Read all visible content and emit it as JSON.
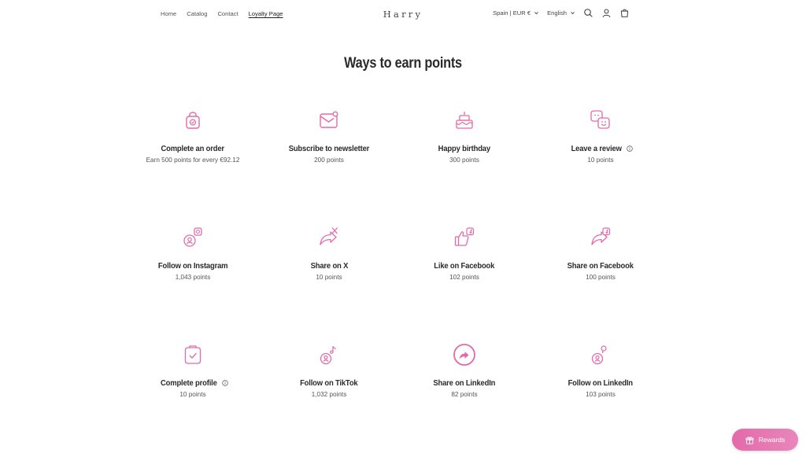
{
  "header": {
    "nav": [
      "Home",
      "Catalog",
      "Contact",
      "Loyalty Page"
    ],
    "logo": "Harry",
    "region": "Spain | EUR €",
    "language": "English"
  },
  "page_title": "Ways to earn points",
  "colors": {
    "accent": "#e36aa9",
    "text": "#2a2a2a"
  },
  "rules": [
    {
      "name": "Complete an order",
      "points": "Earn 500 points for every €92.12",
      "icon": "shopping-bag-icon",
      "info": false
    },
    {
      "name": "Subscribe to newsletter",
      "points": "200 points",
      "icon": "newsletter-icon",
      "info": false
    },
    {
      "name": "Happy birthday",
      "points": "300 points",
      "icon": "birthday-cake-icon",
      "info": false
    },
    {
      "name": "Leave a review",
      "points": "10 points",
      "icon": "review-icon",
      "info": true
    },
    {
      "name": "Follow on Instagram",
      "points": "1,043 points",
      "icon": "instagram-follow-icon",
      "info": false
    },
    {
      "name": "Share on X",
      "points": "10 points",
      "icon": "x-share-icon",
      "info": false
    },
    {
      "name": "Like on Facebook",
      "points": "102 points",
      "icon": "facebook-like-icon",
      "info": false
    },
    {
      "name": "Share on Facebook",
      "points": "100 points",
      "icon": "facebook-share-icon",
      "info": false
    },
    {
      "name": "Complete profile",
      "points": "10 points",
      "icon": "clipboard-check-icon",
      "info": true
    },
    {
      "name": "Follow on TikTok",
      "points": "1,032 points",
      "icon": "tiktok-follow-icon",
      "info": false
    },
    {
      "name": "Share on LinkedIn",
      "points": "82 points",
      "icon": "linkedin-share-icon",
      "info": false
    },
    {
      "name": "Follow on LinkedIn",
      "points": "103 points",
      "icon": "linkedin-follow-icon",
      "info": false
    }
  ],
  "rewards_button": "Rewards"
}
